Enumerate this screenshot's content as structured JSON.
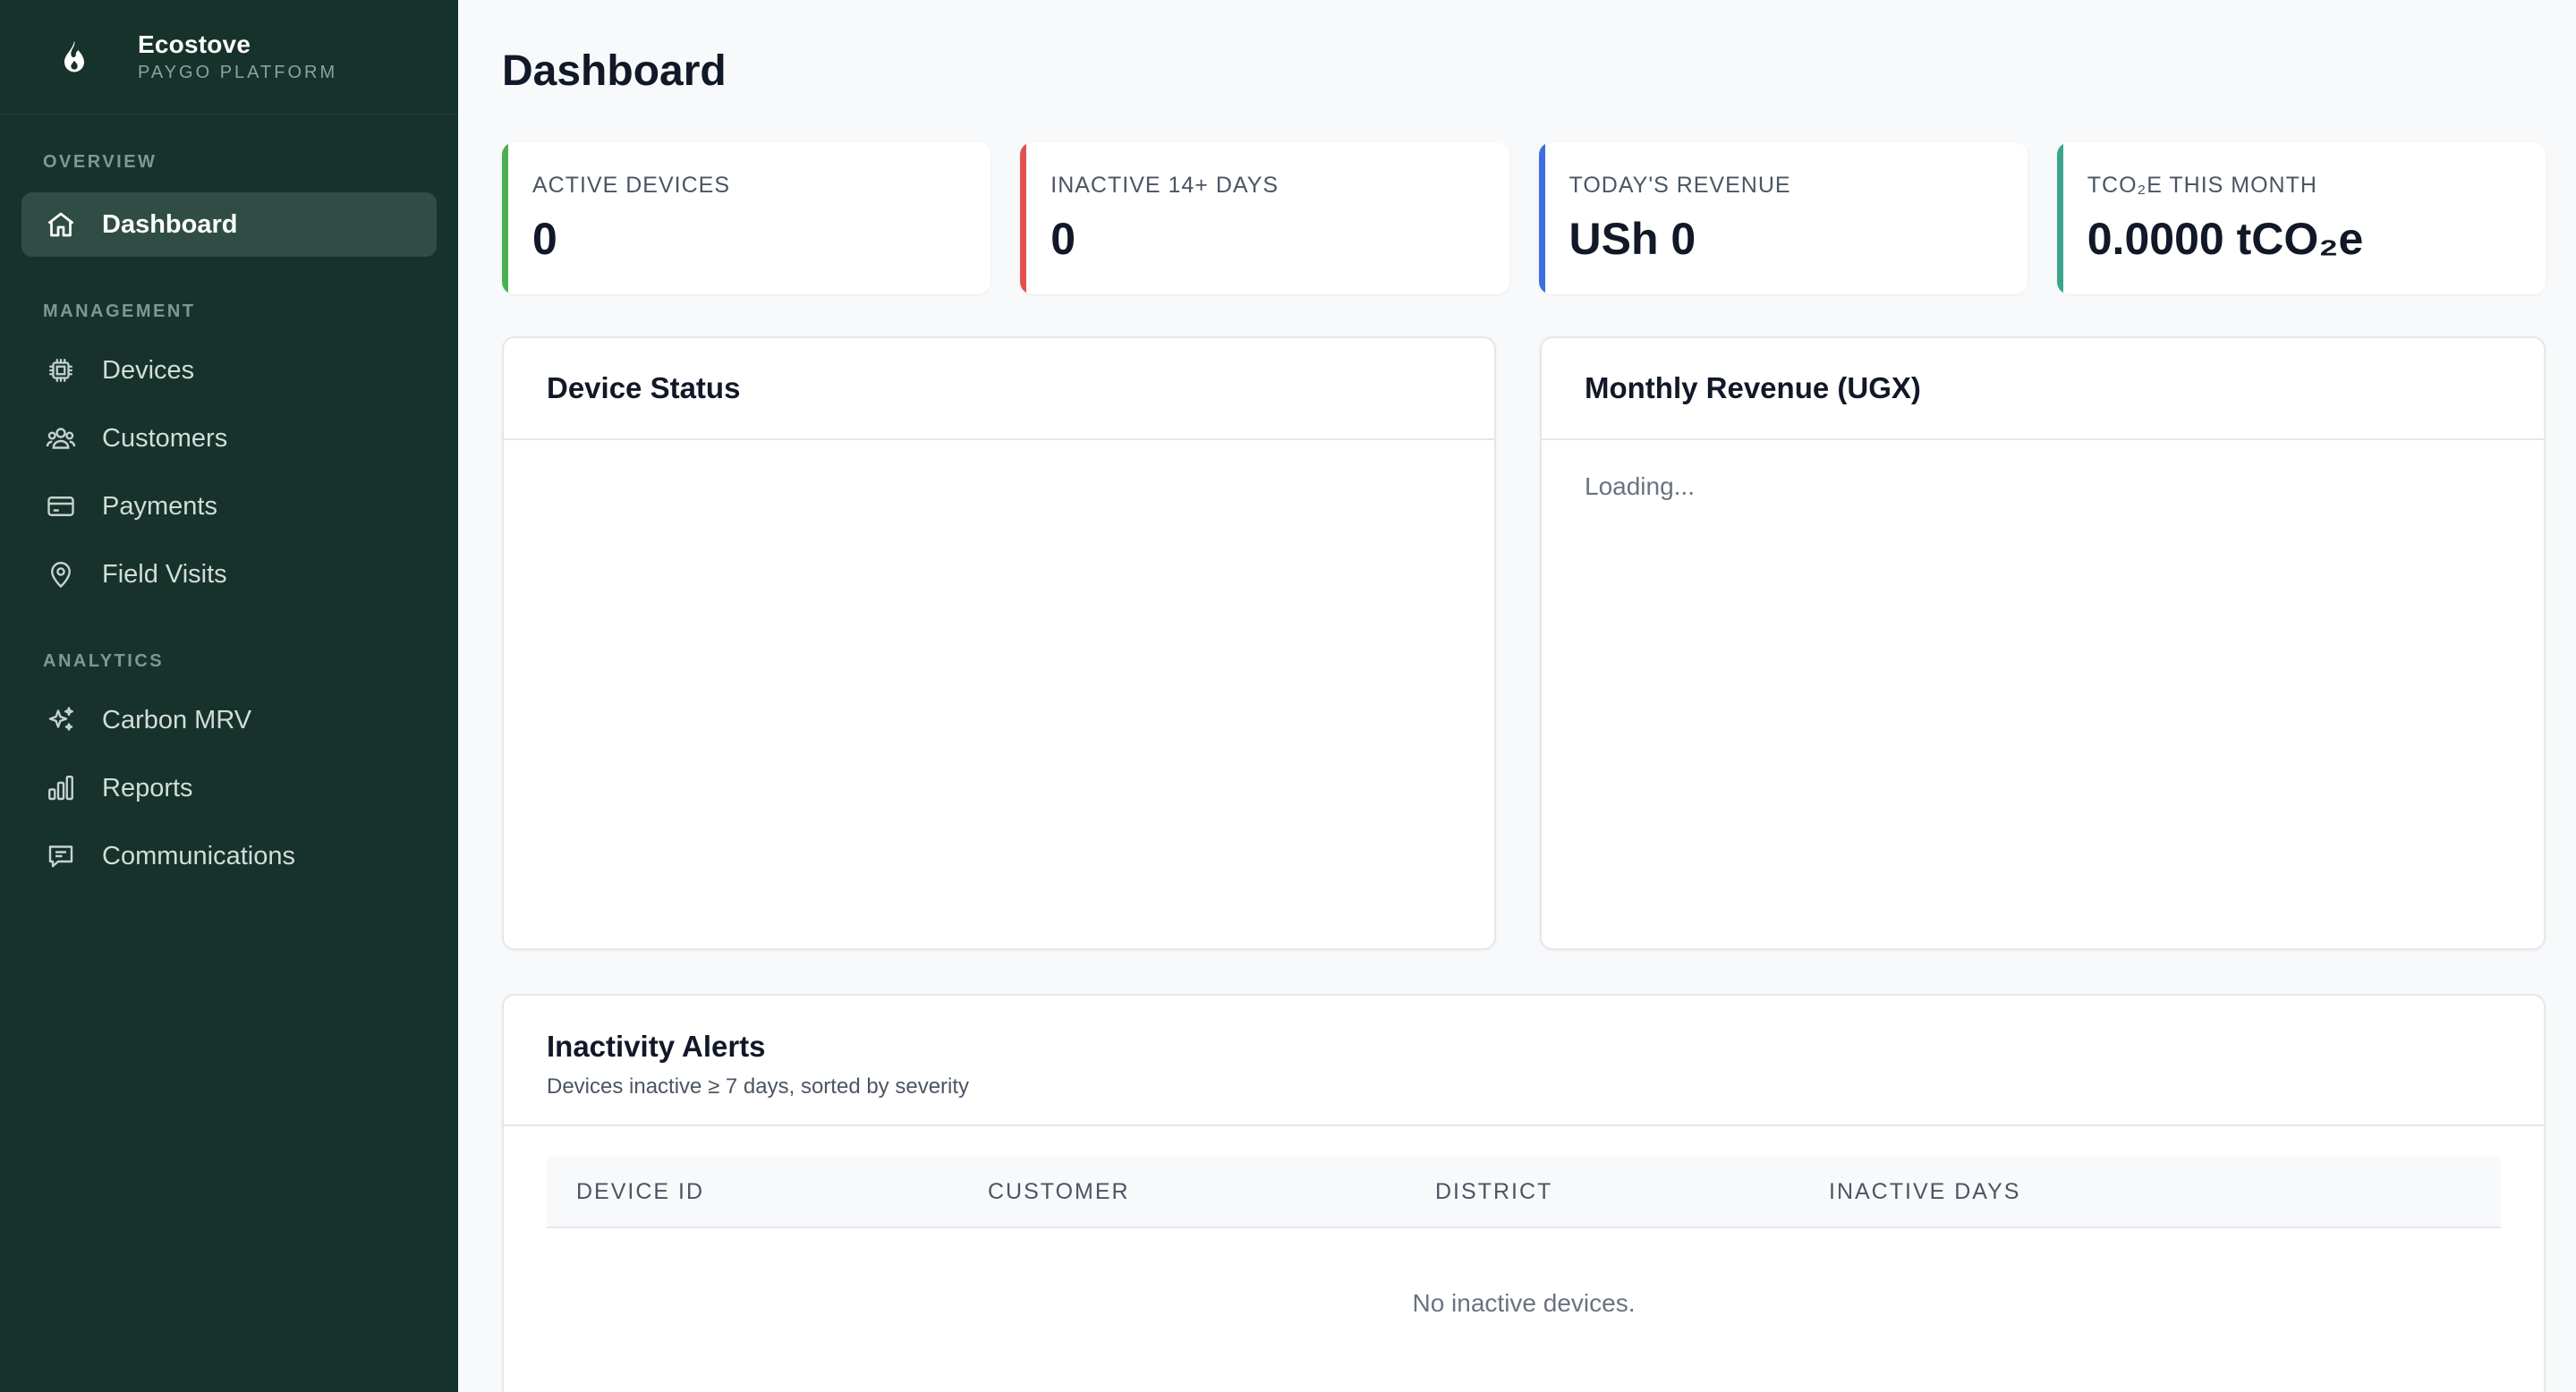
{
  "brand": {
    "name": "Ecostove",
    "subtitle": "PAYGO PLATFORM",
    "logo_icon": "flame-icon"
  },
  "sidebar": {
    "sections": [
      {
        "label": "OVERVIEW",
        "items": [
          {
            "label": "Dashboard",
            "icon": "home-icon",
            "active": true
          }
        ]
      },
      {
        "label": "MANAGEMENT",
        "items": [
          {
            "label": "Devices",
            "icon": "chip-icon"
          },
          {
            "label": "Customers",
            "icon": "users-icon"
          },
          {
            "label": "Payments",
            "icon": "credit-card-icon"
          },
          {
            "label": "Field Visits",
            "icon": "map-pin-icon"
          }
        ]
      },
      {
        "label": "ANALYTICS",
        "items": [
          {
            "label": "Carbon MRV",
            "icon": "sparkles-icon"
          },
          {
            "label": "Reports",
            "icon": "bar-chart-icon"
          },
          {
            "label": "Communications",
            "icon": "message-icon"
          }
        ]
      }
    ]
  },
  "page": {
    "title": "Dashboard"
  },
  "stats": [
    {
      "label": "ACTIVE DEVICES",
      "value": "0",
      "accent": "#4caf50"
    },
    {
      "label": "INACTIVE 14+ DAYS",
      "value": "0",
      "accent": "#e05252"
    },
    {
      "label": "TODAY'S REVENUE",
      "value": "USh 0",
      "accent": "#3b6fe0"
    },
    {
      "label": "TCO₂E THIS MONTH",
      "value": "0.0000 tCO₂e",
      "accent": "#3aa58c"
    }
  ],
  "device_status": {
    "title": "Device Status"
  },
  "monthly_revenue": {
    "title": "Monthly Revenue (UGX)",
    "status": "Loading..."
  },
  "alerts": {
    "title": "Inactivity Alerts",
    "subtitle": "Devices inactive ≥ 7 days, sorted by severity",
    "columns": [
      "DEVICE ID",
      "CUSTOMER",
      "DISTRICT",
      "INACTIVE DAYS"
    ],
    "empty_text": "No inactive devices."
  }
}
